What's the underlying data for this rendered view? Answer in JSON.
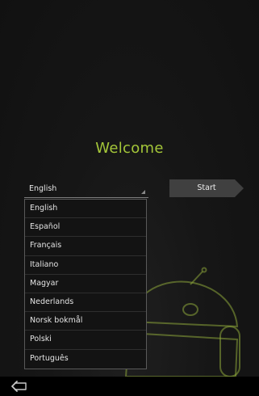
{
  "welcome": {
    "title": "Welcome"
  },
  "language": {
    "selected": "English",
    "options": [
      "English",
      "Español",
      "Français",
      "Italiano",
      "Magyar",
      "Nederlands",
      "Norsk bokmål",
      "Polski",
      "Português"
    ]
  },
  "start_button": {
    "label": "Start"
  },
  "colors": {
    "accent": "#a4c639",
    "background": "#141414",
    "button": "#404040"
  },
  "icons": {
    "back": "back-arrow-icon",
    "mascot": "android-robot-icon",
    "dropdown": "dropdown-caret-icon"
  }
}
